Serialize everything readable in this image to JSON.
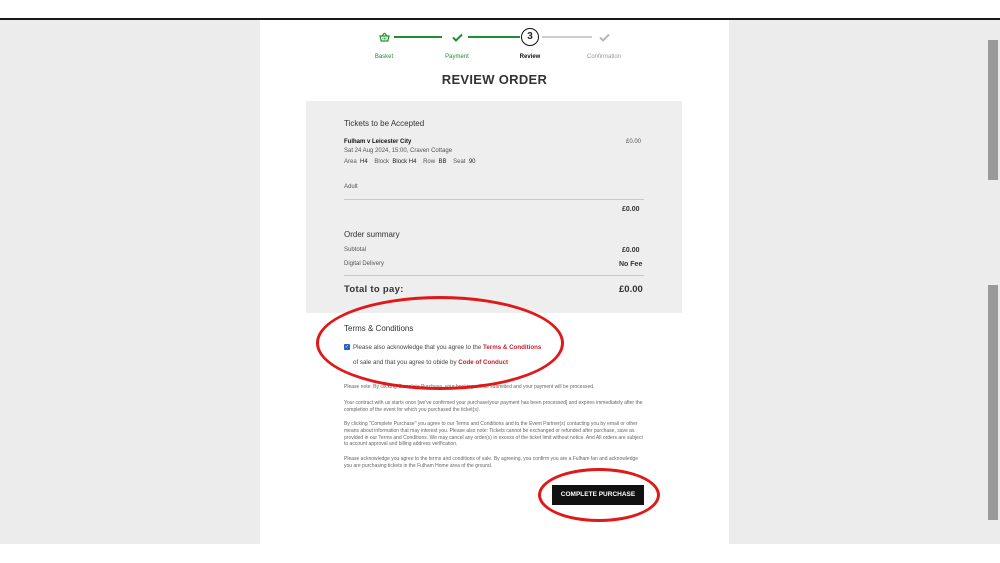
{
  "steps": [
    {
      "label": "Basket",
      "icon": "basket-icon"
    },
    {
      "label": "Payment",
      "icon": "check-icon"
    },
    {
      "label": "Review",
      "number": "3"
    },
    {
      "label": "Confirmation",
      "icon": "check-icon"
    }
  ],
  "page_title": "REVIEW ORDER",
  "tickets": {
    "heading": "Tickets to be Accepted",
    "match": "Fulham v Leicester City",
    "price": "£0.00",
    "datetime": "Sat 24 Aug 2024, 15:00, Craven Cottage",
    "seat": {
      "area_label": "Area",
      "area": "H4",
      "block_label": "Block",
      "block": "Block H4",
      "row_label": "Row",
      "row": "BB",
      "seat_label": "Seat",
      "seat": "90"
    },
    "ticket_type": "Adult",
    "line_total": "£0.00"
  },
  "summary": {
    "heading": "Order summary",
    "subtotal_label": "Subtotal",
    "subtotal": "£0.00",
    "delivery_label": "Digital Delivery",
    "delivery": "No Fee",
    "total_label": "Total to pay:",
    "total": "£0.00"
  },
  "terms": {
    "heading": "Terms & Conditions",
    "ack_1": "Please also acknowledge that you agree to the",
    "ack_link_1": "Terms & Conditions",
    "ack_2": "of sale and that you agree to obide by",
    "ack_link_2": "Code of Conduct",
    "checked": true,
    "para_1": "Please note: By clicking Complete Purchase, your booking will be submitted and your payment will be processed.",
    "para_2": "Your contract with us starts once [we've confirmed your purchase/your payment has been processed] and expires immediately after the completion of the event for which you purchased the ticket(s).",
    "para_3": "By clicking \"Complete Purchase\" you agree to our Terms and Conditions and to the Event Partner(s) contacting you by email or other means about information that may interest you. Please also note: Tickets cannot be exchanged or refunded after purchase, save as provided in our Terms and Conditions. We may cancel any order(s) in excess of the ticket limit without notice. And All orders are subject to account approval and billing address verification.",
    "para_4": "Please acknowledge you agree to the terms and conditions of sale. By agreeing, you confirm you are a Fulham fan and acknowledge you are purchasing tickets in the Fulham Home area of the ground."
  },
  "complete_button": "COMPLETE PURCHASE",
  "colors": {
    "step_done": "#1f8f2f",
    "accent_red": "#c81e2d",
    "annotation_red": "#e01818"
  }
}
